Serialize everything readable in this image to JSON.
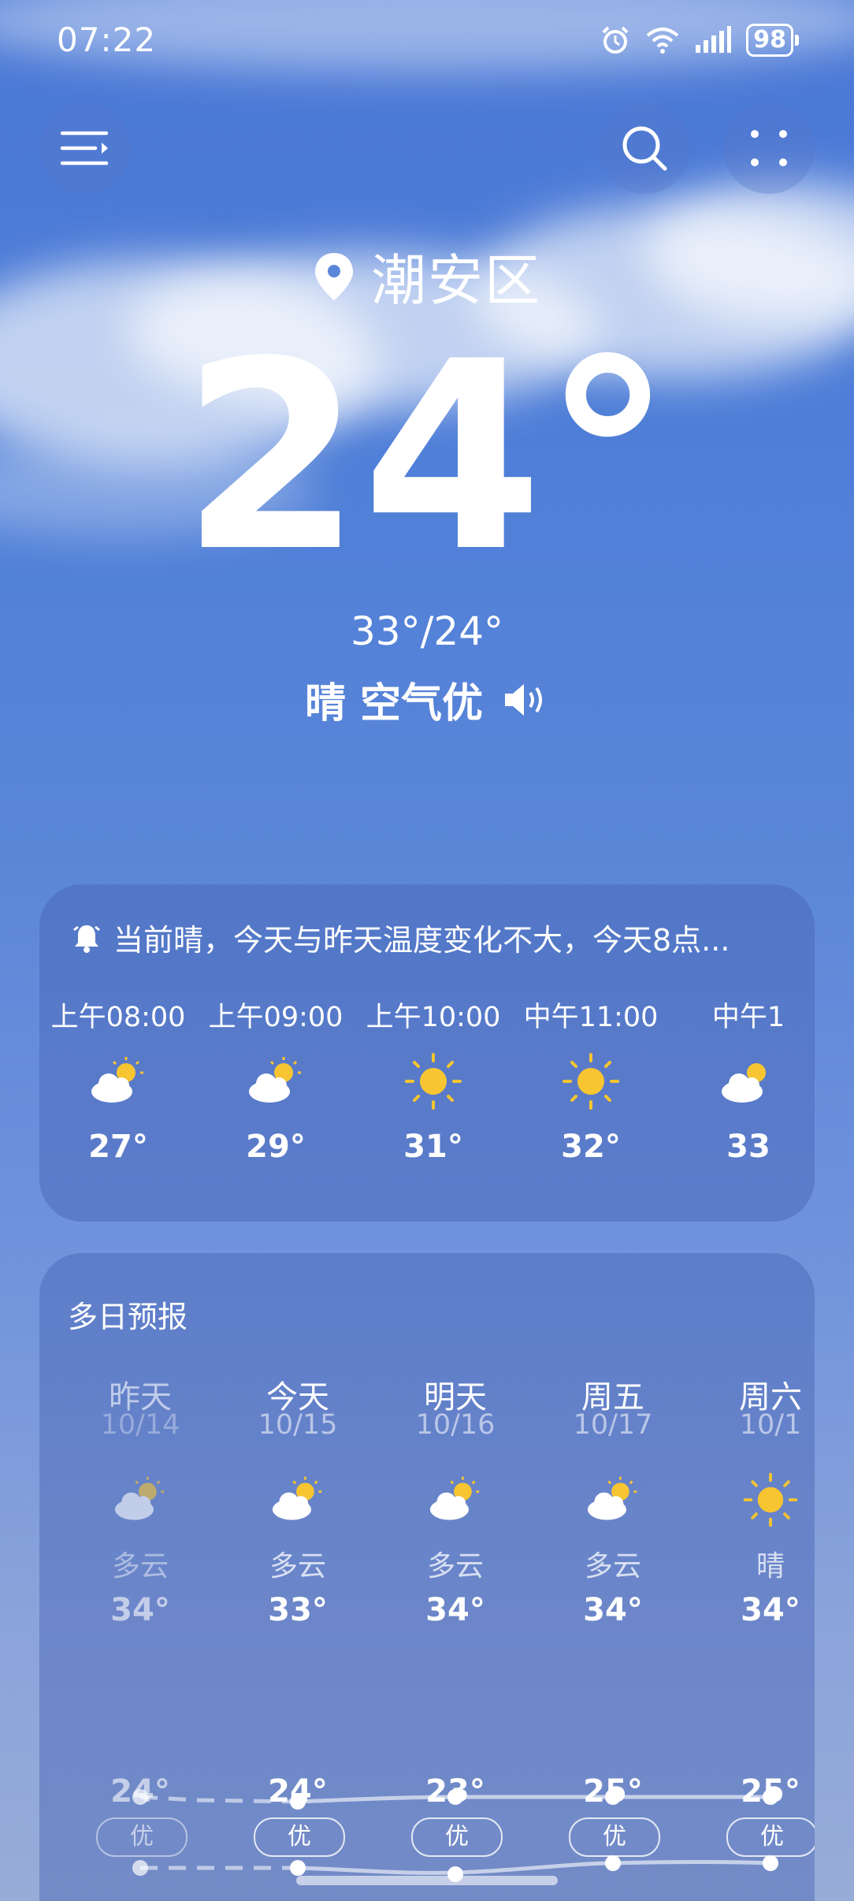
{
  "status_bar": {
    "time": "07:22",
    "battery": "98",
    "icons": [
      "alarm-icon",
      "wifi-icon",
      "signal-icon",
      "battery-icon"
    ]
  },
  "header": {
    "menu_icon": "menu-icon",
    "search_icon": "search-icon",
    "more_icon": "more-icon"
  },
  "current": {
    "location": "潮安区",
    "temperature": "24°",
    "range": "33°/24°",
    "condition": "晴 空气优",
    "voice_icon": "speaker-icon"
  },
  "hourly": {
    "notice": "当前晴，今天与昨天温度变化不大，今天8点...",
    "items": [
      {
        "time": "上午08:00",
        "icon": "partly-cloudy-icon",
        "temp": "27°"
      },
      {
        "time": "上午09:00",
        "icon": "partly-cloudy-icon",
        "temp": "29°"
      },
      {
        "time": "上午10:00",
        "icon": "sun-icon",
        "temp": "31°"
      },
      {
        "time": "中午11:00",
        "icon": "sun-icon",
        "temp": "32°"
      },
      {
        "time": "中午1",
        "icon": "partly-cloudy-icon",
        "temp": "33"
      }
    ]
  },
  "daily": {
    "title": "多日预报",
    "items": [
      {
        "name": "昨天",
        "date": "10/14",
        "icon": "partly-cloudy-icon",
        "cond": "多云",
        "high": "34°",
        "low": "24°",
        "aqi": "优"
      },
      {
        "name": "今天",
        "date": "10/15",
        "icon": "partly-cloudy-icon",
        "cond": "多云",
        "high": "33°",
        "low": "24°",
        "aqi": "优"
      },
      {
        "name": "明天",
        "date": "10/16",
        "icon": "partly-cloudy-icon",
        "cond": "多云",
        "high": "34°",
        "low": "23°",
        "aqi": "优"
      },
      {
        "name": "周五",
        "date": "10/17",
        "icon": "partly-cloudy-icon",
        "cond": "多云",
        "high": "34°",
        "low": "25°",
        "aqi": "优"
      },
      {
        "name": "周六",
        "date": "10/1",
        "icon": "sun-icon",
        "cond": "晴",
        "high": "34°",
        "low": "25°",
        "aqi": "优"
      }
    ]
  },
  "colors": {
    "sky": "#4f7fd8",
    "sun": "#f7c531",
    "card": "#5a78c4"
  }
}
